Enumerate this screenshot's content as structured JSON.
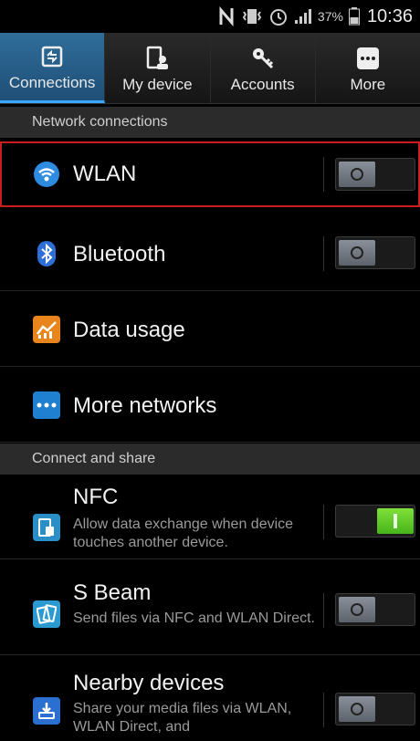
{
  "status": {
    "battery_percent": "37%",
    "time": "10:36",
    "icons": [
      "nfc-icon",
      "vibrate-icon",
      "alarm-icon",
      "signal-icon",
      "battery-icon"
    ]
  },
  "tabs": [
    {
      "label": "Connections",
      "icon": "connections-icon",
      "active": true
    },
    {
      "label": "My device",
      "icon": "my-device-icon",
      "active": false
    },
    {
      "label": "Accounts",
      "icon": "accounts-key-icon",
      "active": false
    },
    {
      "label": "More",
      "icon": "more-icon",
      "active": false
    }
  ],
  "sections": {
    "network": "Network connections",
    "share": "Connect and share"
  },
  "network_items": [
    {
      "title": "WLAN",
      "icon": "wifi-icon",
      "toggle": "off"
    },
    {
      "title": "Bluetooth",
      "icon": "bluetooth-icon",
      "toggle": "off"
    },
    {
      "title": "Data usage",
      "icon": "data-usage-icon"
    },
    {
      "title": "More networks",
      "icon": "more-networks-icon"
    }
  ],
  "share_items": [
    {
      "title": "NFC",
      "subtitle": "Allow data exchange when device touches another device.",
      "icon": "nfc-icon",
      "toggle": "on"
    },
    {
      "title": "S Beam",
      "subtitle": "Send files via NFC and WLAN Direct.",
      "icon": "s-beam-icon",
      "toggle": "off"
    },
    {
      "title": "Nearby devices",
      "subtitle": "Share your media files via WLAN, WLAN Direct, and",
      "icon": "nearby-devices-icon",
      "toggle": "off"
    }
  ],
  "colors": {
    "accent_tab": "#2f6d9a",
    "toggle_on": "#47b51a",
    "highlight": "#c81e1e"
  }
}
